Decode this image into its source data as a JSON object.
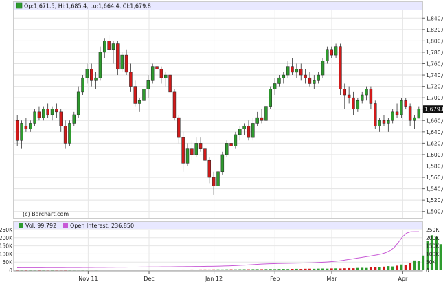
{
  "legend": {
    "ohlc_text": "Op:1,671.5, Hi:1,685.4, Lo:1,664.4, Cl:1,679.8",
    "volume_text": "Vol: 99,792",
    "oi_text": "Open Interest: 236,850"
  },
  "watermark": "(c) Barchart.com",
  "last_price_label": "1,679.8",
  "colors": {
    "up": "#2e9b2e",
    "down": "#d11a1a",
    "oi_line": "#c85ad6",
    "header_bg": "#e8e8ff",
    "price_tag_bg": "#111111"
  },
  "chart_data": [
    {
      "type": "candlestick",
      "title": "",
      "ylabel": "",
      "ylim": [
        1490,
        1850
      ],
      "y_ticks": [
        "1,840,0",
        "1,820,0",
        "1,800,0",
        "1,780,0",
        "1,760,0",
        "1,740,0",
        "1,720,0",
        "1,700,0",
        "1,680,0",
        "1,660,0",
        "1,640,0",
        "1,620,0",
        "1,600,0",
        "1,580,0",
        "1,560,0",
        "1,540,0",
        "1,520,0",
        "1,500,0"
      ],
      "x_ticks": [
        "Nov 11",
        "Dec",
        "Jan 12",
        "Feb",
        "Mar",
        "Apr"
      ],
      "grid": true,
      "candles": [
        [
          1660,
          1670,
          1615,
          1625
        ],
        [
          1625,
          1660,
          1610,
          1655
        ],
        [
          1650,
          1665,
          1640,
          1645
        ],
        [
          1645,
          1660,
          1640,
          1655
        ],
        [
          1655,
          1680,
          1650,
          1675
        ],
        [
          1675,
          1685,
          1660,
          1665
        ],
        [
          1665,
          1685,
          1660,
          1680
        ],
        [
          1680,
          1690,
          1665,
          1670
        ],
        [
          1670,
          1685,
          1660,
          1680
        ],
        [
          1680,
          1690,
          1665,
          1675
        ],
        [
          1675,
          1680,
          1640,
          1650
        ],
        [
          1650,
          1660,
          1610,
          1620
        ],
        [
          1620,
          1660,
          1615,
          1655
        ],
        [
          1655,
          1675,
          1650,
          1670
        ],
        [
          1670,
          1720,
          1665,
          1710
        ],
        [
          1710,
          1740,
          1705,
          1735
        ],
        [
          1735,
          1760,
          1725,
          1750
        ],
        [
          1750,
          1760,
          1720,
          1730
        ],
        [
          1730,
          1745,
          1715,
          1735
        ],
        [
          1735,
          1790,
          1730,
          1780
        ],
        [
          1780,
          1805,
          1770,
          1800
        ],
        [
          1800,
          1810,
          1780,
          1785
        ],
        [
          1785,
          1800,
          1760,
          1795
        ],
        [
          1795,
          1800,
          1740,
          1750
        ],
        [
          1750,
          1780,
          1745,
          1775
        ],
        [
          1775,
          1785,
          1740,
          1745
        ],
        [
          1745,
          1760,
          1710,
          1720
        ],
        [
          1720,
          1730,
          1685,
          1690
        ],
        [
          1690,
          1700,
          1675,
          1695
        ],
        [
          1695,
          1720,
          1690,
          1715
        ],
        [
          1715,
          1740,
          1700,
          1730
        ],
        [
          1730,
          1760,
          1725,
          1755
        ],
        [
          1755,
          1770,
          1740,
          1750
        ],
        [
          1750,
          1755,
          1725,
          1735
        ],
        [
          1735,
          1745,
          1720,
          1740
        ],
        [
          1740,
          1750,
          1700,
          1710
        ],
        [
          1710,
          1715,
          1660,
          1665
        ],
        [
          1665,
          1670,
          1620,
          1630
        ],
        [
          1630,
          1640,
          1570,
          1585
        ],
        [
          1585,
          1620,
          1580,
          1610
        ],
        [
          1610,
          1625,
          1590,
          1600
        ],
        [
          1600,
          1630,
          1595,
          1620
        ],
        [
          1620,
          1630,
          1605,
          1610
        ],
        [
          1610,
          1615,
          1580,
          1590
        ],
        [
          1590,
          1595,
          1550,
          1560
        ],
        [
          1560,
          1570,
          1530,
          1545
        ],
        [
          1545,
          1580,
          1540,
          1570
        ],
        [
          1570,
          1605,
          1565,
          1600
        ],
        [
          1600,
          1625,
          1595,
          1620
        ],
        [
          1620,
          1630,
          1610,
          1615
        ],
        [
          1615,
          1640,
          1610,
          1635
        ],
        [
          1635,
          1650,
          1625,
          1645
        ],
        [
          1645,
          1655,
          1635,
          1650
        ],
        [
          1650,
          1660,
          1625,
          1630
        ],
        [
          1630,
          1665,
          1625,
          1655
        ],
        [
          1655,
          1675,
          1650,
          1665
        ],
        [
          1665,
          1680,
          1655,
          1660
        ],
        [
          1660,
          1690,
          1655,
          1685
        ],
        [
          1685,
          1720,
          1680,
          1715
        ],
        [
          1715,
          1735,
          1705,
          1725
        ],
        [
          1725,
          1740,
          1720,
          1735
        ],
        [
          1735,
          1745,
          1725,
          1740
        ],
        [
          1740,
          1765,
          1735,
          1755
        ],
        [
          1755,
          1770,
          1740,
          1745
        ],
        [
          1745,
          1760,
          1735,
          1750
        ],
        [
          1750,
          1760,
          1730,
          1740
        ],
        [
          1740,
          1750,
          1725,
          1735
        ],
        [
          1735,
          1745,
          1720,
          1725
        ],
        [
          1725,
          1740,
          1715,
          1730
        ],
        [
          1730,
          1745,
          1725,
          1740
        ],
        [
          1740,
          1770,
          1735,
          1765
        ],
        [
          1765,
          1790,
          1760,
          1785
        ],
        [
          1785,
          1790,
          1770,
          1775
        ],
        [
          1775,
          1795,
          1770,
          1790
        ],
        [
          1790,
          1795,
          1705,
          1715
        ],
        [
          1715,
          1725,
          1680,
          1705
        ],
        [
          1705,
          1720,
          1690,
          1700
        ],
        [
          1700,
          1710,
          1670,
          1680
        ],
        [
          1680,
          1700,
          1675,
          1695
        ],
        [
          1695,
          1710,
          1690,
          1705
        ],
        [
          1705,
          1720,
          1695,
          1715
        ],
        [
          1715,
          1720,
          1680,
          1690
        ],
        [
          1690,
          1695,
          1645,
          1650
        ],
        [
          1650,
          1665,
          1640,
          1660
        ],
        [
          1660,
          1670,
          1650,
          1655
        ],
        [
          1655,
          1665,
          1640,
          1660
        ],
        [
          1660,
          1680,
          1655,
          1675
        ],
        [
          1675,
          1690,
          1665,
          1670
        ],
        [
          1670,
          1700,
          1665,
          1695
        ],
        [
          1695,
          1700,
          1680,
          1685
        ],
        [
          1685,
          1690,
          1650,
          1660
        ],
        [
          1660,
          1670,
          1645,
          1665
        ],
        [
          1664,
          1685,
          1664,
          1680
        ]
      ]
    },
    {
      "type": "bar",
      "title": "",
      "ylim": [
        0,
        250000
      ],
      "y_ticks": [
        "0",
        "50K",
        "100K",
        "150K",
        "200K",
        "250K"
      ],
      "series": [
        {
          "name": "Vol",
          "values": [
            1000,
            1200,
            900,
            1100,
            1300,
            1000,
            1200,
            1400,
            1100,
            1300,
            1500,
            1200,
            1400,
            1600,
            1800,
            1500,
            1700,
            2000,
            1800,
            2200,
            2500,
            2100,
            2300,
            2600,
            2400,
            2800,
            3000,
            2700,
            3100,
            3300,
            3000,
            3400,
            3600,
            3200,
            3800,
            4000,
            3700,
            4100,
            4300,
            4000,
            4500,
            4200,
            4800,
            5000,
            4700,
            5200,
            5500,
            5100,
            5800,
            6000,
            5600,
            6200,
            6500,
            6100,
            6800,
            7000,
            6600,
            7300,
            7600,
            7100,
            7900,
            8200,
            7700,
            8500,
            8800,
            8300,
            9200,
            9500,
            9000,
            10000,
            10500,
            9800,
            11000,
            11500,
            10700,
            12000,
            13000,
            12200,
            14000,
            15000,
            14000,
            17000,
            20000,
            18000,
            22000,
            25000,
            23000,
            28000,
            35000,
            30000,
            45000,
            60000,
            55000,
            90000,
            180000,
            215000,
            205000,
            160000,
            99792
          ]
        },
        {
          "name": "Open Interest",
          "values": [
            15000,
            15100,
            15200,
            15300,
            15400,
            15500,
            15600,
            15700,
            15800,
            15900,
            16000,
            16100,
            16200,
            16300,
            16400,
            16500,
            16700,
            16900,
            17100,
            17300,
            17500,
            17700,
            17900,
            18100,
            18300,
            18500,
            18700,
            18900,
            19100,
            19300,
            19500,
            19700,
            19900,
            20100,
            20300,
            20500,
            20700,
            20900,
            21200,
            21500,
            21800,
            22100,
            22400,
            22700,
            23000,
            23300,
            23600,
            24000,
            24500,
            25000,
            25800,
            26700,
            27700,
            28800,
            30000,
            31400,
            33000,
            34500,
            36000,
            37500,
            38500,
            39500,
            40500,
            41200,
            41800,
            42300,
            42800,
            43300,
            43800,
            44300,
            45000,
            45800,
            46800,
            48000,
            49400,
            51000,
            53000,
            55500,
            58500,
            62000,
            66000,
            70000,
            74000,
            78000,
            82000,
            86000,
            90500,
            95000,
            100000,
            108000,
            120000,
            140000,
            170000,
            205000,
            228000,
            236000,
            236500,
            236850
          ]
        }
      ]
    }
  ]
}
